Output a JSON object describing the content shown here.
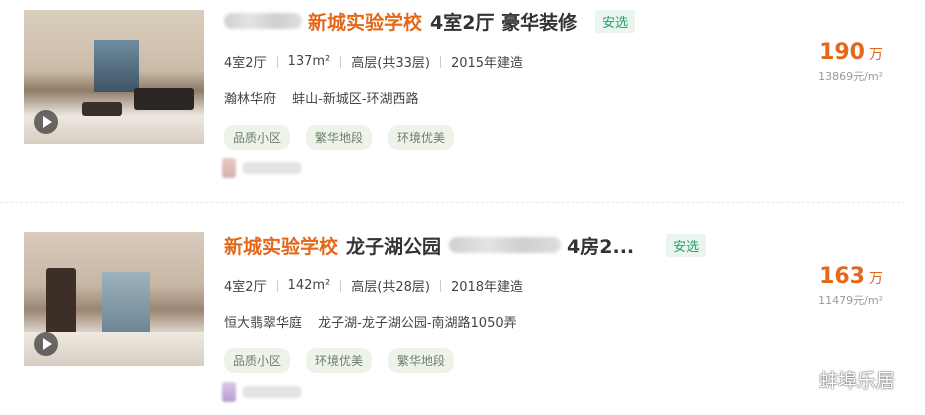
{
  "listings": [
    {
      "title_highlight": "新城实验学校",
      "title_rest": "4室2厅 豪华装修",
      "badge": "安选",
      "layout": "4室2厅",
      "area": "137m²",
      "floor": "高层(共33层)",
      "built": "2015年建造",
      "community": "瀚林华府",
      "location": "蚌山-新城区-环湖西路",
      "tags": [
        "品质小区",
        "繁华地段",
        "环境优美"
      ],
      "price_total": "190",
      "price_unit": "万",
      "price_per_sqm": "13869元/m²"
    },
    {
      "title_highlight": "新城实验学校",
      "title_rest_a": "龙子湖公园",
      "title_rest_b": "4房2...",
      "badge": "安选",
      "layout": "4室2厅",
      "area": "142m²",
      "floor": "高层(共28层)",
      "built": "2018年建造",
      "community": "恒大翡翠华庭",
      "location": "龙子湖-龙子湖公园-南湖路1050弄",
      "tags": [
        "品质小区",
        "环境优美",
        "繁华地段"
      ],
      "price_total": "163",
      "price_unit": "万",
      "price_per_sqm": "11479元/m²"
    }
  ],
  "watermark": {
    "text": "蚌埠乐居",
    "icon": "wechat-icon"
  }
}
